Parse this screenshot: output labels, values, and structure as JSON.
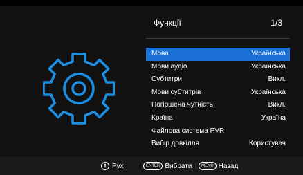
{
  "menu": {
    "title": "Функції",
    "page": "1/3",
    "items": [
      {
        "label": "Мова",
        "value": "Українська",
        "selected": true
      },
      {
        "label": "Мови аудіо",
        "value": "Українська"
      },
      {
        "label": "Субтитри",
        "value": "Викл."
      },
      {
        "label": "Мови субтитрів",
        "value": "Українська"
      },
      {
        "label": "Погіршена чутність",
        "value": "Викл."
      },
      {
        "label": "Країна",
        "value": "Україна"
      },
      {
        "label": "Файлова система PVR",
        "value": ""
      },
      {
        "label": "Вибір довкілля",
        "value": "Користувач"
      }
    ]
  },
  "footer": {
    "move": {
      "label": "Рух",
      "icon": "dpad-icon"
    },
    "enter": {
      "key": "ENTER",
      "label": "Вибрати"
    },
    "menu": {
      "key": "MENU",
      "label": "Назад"
    }
  },
  "colors": {
    "accent": "#1b70d8",
    "gear": "#1a8fe6"
  },
  "icons": {
    "settings": "gear-icon"
  }
}
